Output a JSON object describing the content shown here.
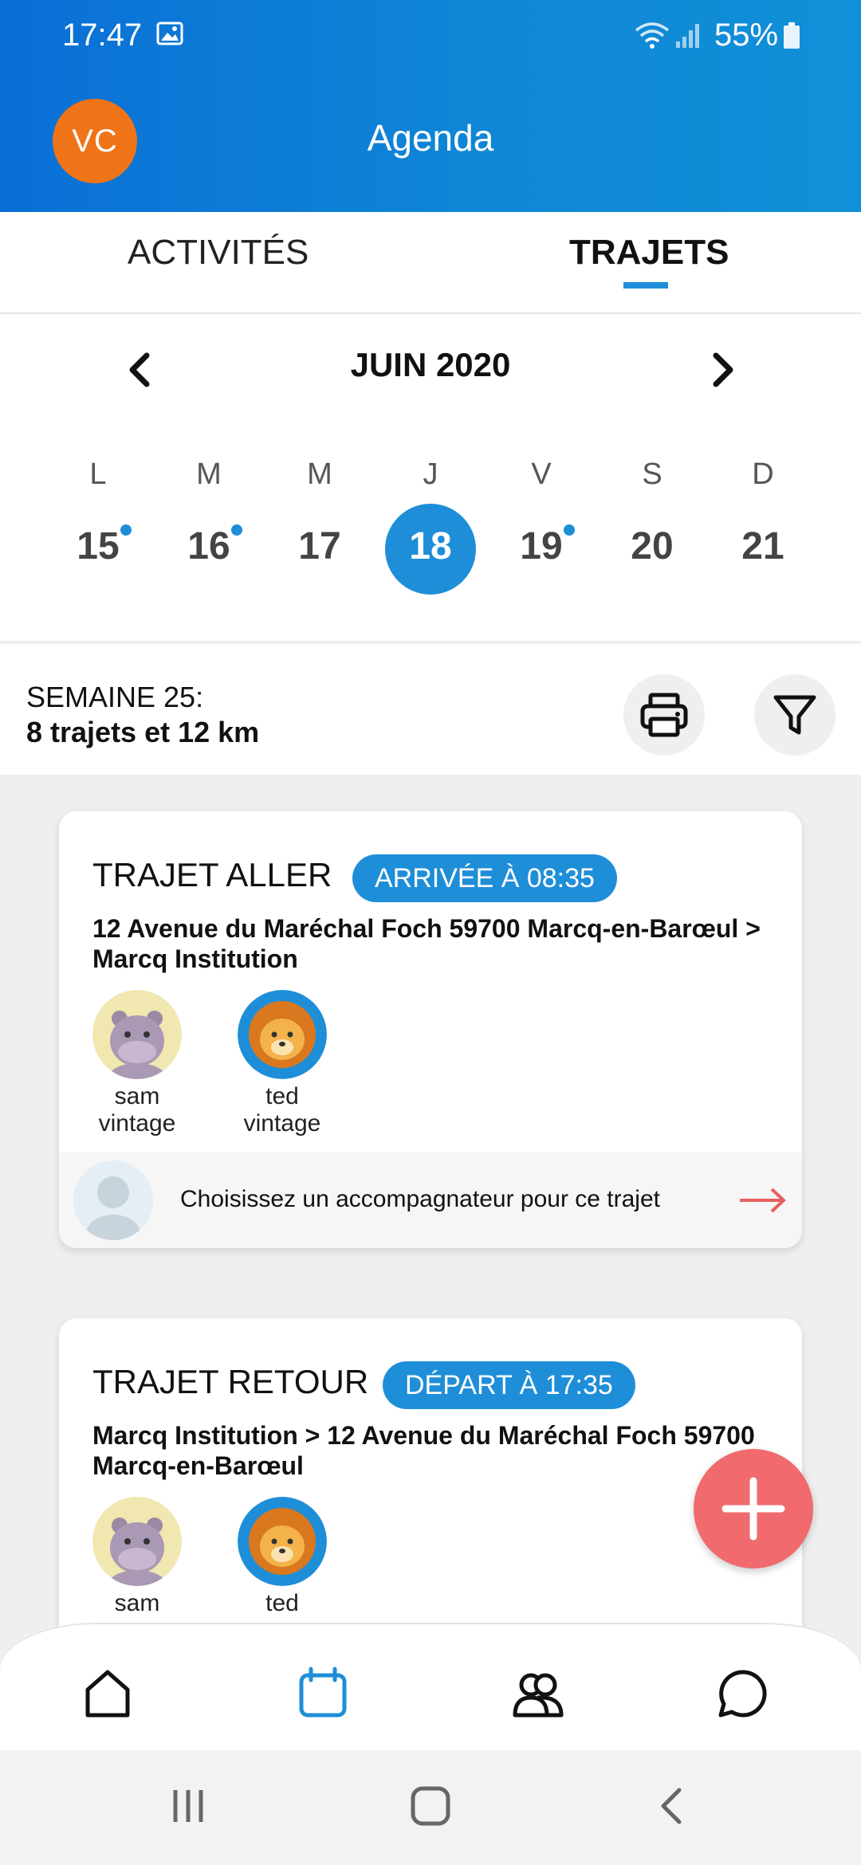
{
  "status_bar": {
    "time": "17:47",
    "battery": "55%"
  },
  "header": {
    "avatar_initials": "VC",
    "title": "Agenda"
  },
  "tabs": [
    {
      "label": "ACTIVITÉS",
      "active": false
    },
    {
      "label": "TRAJETS",
      "active": true
    }
  ],
  "calendar": {
    "month": "JUIN 2020",
    "days": [
      {
        "letter": "L",
        "num": "15",
        "has_event": true,
        "selected": false
      },
      {
        "letter": "M",
        "num": "16",
        "has_event": true,
        "selected": false
      },
      {
        "letter": "M",
        "num": "17",
        "has_event": false,
        "selected": false
      },
      {
        "letter": "J",
        "num": "18",
        "has_event": false,
        "selected": true
      },
      {
        "letter": "V",
        "num": "19",
        "has_event": true,
        "selected": false
      },
      {
        "letter": "S",
        "num": "20",
        "has_event": false,
        "selected": false
      },
      {
        "letter": "D",
        "num": "21",
        "has_event": false,
        "selected": false
      }
    ]
  },
  "week": {
    "label": "SEMAINE 25:",
    "summary": "8 trajets et 12 km"
  },
  "trips": [
    {
      "title": "TRAJET ALLER",
      "badge": "ARRIVÉE À 08:35",
      "route": "12 Avenue du Maréchal Foch 59700 Marcq-en-Barœul > Marcq Institution",
      "kids": [
        {
          "first": "sam",
          "last": "vintage",
          "avatar": "hippo"
        },
        {
          "first": "ted",
          "last": "vintage",
          "avatar": "lion"
        }
      ],
      "escort_prompt": "Choisissez un accompagnateur pour ce trajet"
    },
    {
      "title": "TRAJET RETOUR",
      "badge": "DÉPART À 17:35",
      "route": "Marcq Institution > 12 Avenue du Maréchal Foch 59700 Marcq-en-Barœul",
      "kids": [
        {
          "first": "sam",
          "avatar": "hippo"
        },
        {
          "first": "ted",
          "avatar": "lion"
        }
      ]
    }
  ],
  "colors": {
    "accent": "#1f8ed8",
    "fab": "#f06a6e",
    "avatar": "#ef7317",
    "arrow": "#e8605f"
  },
  "bottom_nav": [
    "home-icon",
    "calendar-icon",
    "group-icon",
    "chat-icon"
  ]
}
